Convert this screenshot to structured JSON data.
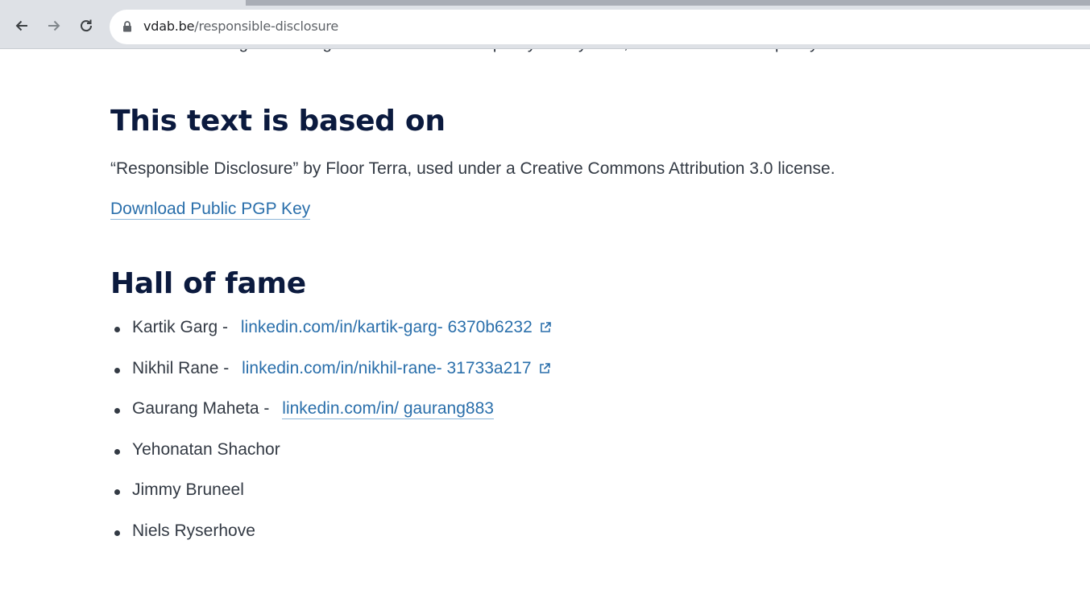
{
  "browser": {
    "url_domain": "vdab.be",
    "url_path": "/responsible-disclosure"
  },
  "page": {
    "cut_off_text": "We reserve the right to change the contents of this policy at any time, or to terminate the policy.",
    "based_on_heading": "This text is based on",
    "attribution": "“Responsible Disclosure” by Floor Terra, used under a Creative Commons Attribution 3.0 license.",
    "pgp_link": "Download Public PGP Key",
    "hall_heading": "Hall of fame",
    "hall_of_fame": [
      {
        "name": "Kartik Garg -",
        "link": "linkedin.com/in/kartik-garg- 6370b6232",
        "external": true
      },
      {
        "name": "Nikhil Rane -",
        "link": "linkedin.com/in/nikhil-rane- 31733a217",
        "external": true
      },
      {
        "name": "Gaurang Maheta -",
        "link": "linkedin.com/in/ gaurang883",
        "external": false
      },
      {
        "name": "Yehonatan Shachor"
      },
      {
        "name": "Jimmy Bruneel"
      },
      {
        "name": "Niels Ryserhove"
      }
    ]
  }
}
